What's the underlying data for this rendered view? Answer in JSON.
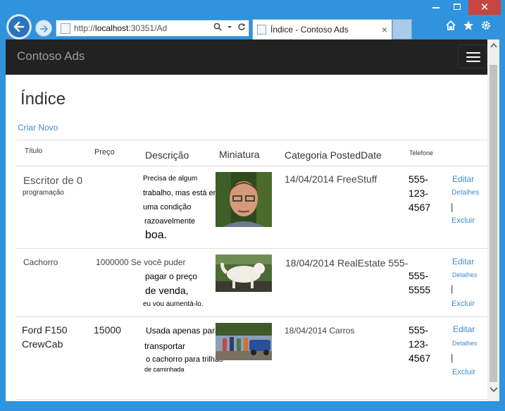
{
  "browser": {
    "url_prefix": "http://",
    "url_host": "localhost",
    "url_rest": ":30351/Ad",
    "tab_title_part1": "Índice - ",
    "tab_title_part2": "Contoso Ads",
    "tab_close": "×",
    "window_close": "✕",
    "icons": [
      "back-arrow-icon",
      "forward-arrow-icon",
      "search-icon",
      "refresh-icon",
      "home-icon",
      "favorites-star-icon",
      "gear-icon"
    ]
  },
  "navbar": {
    "brand": "Contoso Ads"
  },
  "page": {
    "title": "Índice",
    "create_link": "Criar Novo"
  },
  "table": {
    "headers": {
      "title": "Título",
      "price": "Preço",
      "description": "Descrição",
      "thumbnail": "Miniatura",
      "category": "Categoria",
      "posted": "PostedDate",
      "phone": "Telefone"
    },
    "rows": [
      {
        "title_line1": "Escritor de 0",
        "title_line2": "programação",
        "price": "",
        "desc": [
          "Precisa de algum",
          "trabalho, mas está em",
          "uma condição",
          "razoavelmente",
          "boa."
        ],
        "date_category": "14/04/2014 FreeStuff",
        "phone": [
          "555-",
          "123-",
          "4567"
        ],
        "edit": "Editar",
        "details": "Detalhes",
        "sep": "|",
        "delete": "Excluir"
      },
      {
        "title_line1": "Cachorro",
        "price_desc": "1000000 Se você puder",
        "desc": [
          "pagar o preço",
          "de venda,",
          "eu vou aumentá-lo."
        ],
        "date_category": "18/04/2014 RealEstate 555-",
        "phone": [
          "555-",
          "5555"
        ],
        "edit": "Editar",
        "details": "Detalhes",
        "sep": "|",
        "delete": "Excluir"
      },
      {
        "title_line1": "Ford F150",
        "title_line2": "CrewCab",
        "price": "15000",
        "desc": [
          "Usada apenas para",
          "transportar",
          "o cachorro para trilhas",
          "de caminhada"
        ],
        "date_category": "18/04/2014 Carros",
        "phone": [
          "555-",
          "123-",
          "4567"
        ],
        "edit": "Editar",
        "details": "Detalhes",
        "sep": "|",
        "delete": "Excluir"
      }
    ]
  }
}
